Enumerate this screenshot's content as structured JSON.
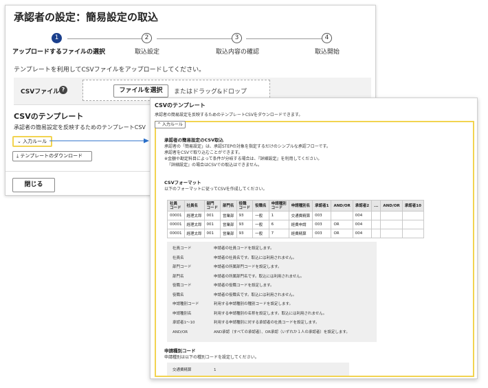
{
  "back_window": {
    "title": "承認者の設定：簡易設定の取込",
    "steps": [
      {
        "number": "1",
        "label": "アップロードするファイルの選択"
      },
      {
        "number": "2",
        "label": "取込設定"
      },
      {
        "number": "3",
        "label": "取込内容の確認"
      },
      {
        "number": "4",
        "label": "取込開始"
      }
    ],
    "description": "テンプレートを利用してCSVファイルをアップロードしてください。",
    "csv_file_label": "CSVファイル",
    "help_icon": "?",
    "select_file_button": "ファイルを選択",
    "drop_text": "またはドラッグ&ドロップ",
    "template_section_title": "CSVのテンプレート",
    "template_section_desc": "承認者の簡易設定を反映するためのテンプレートCSV",
    "input_rule_button": "⌄ 入力ルール",
    "download_button": "⤓ テンプレートのダウンロード",
    "close_button": "閉じる"
  },
  "front_window": {
    "title": "CSVのテンプレート",
    "description": "承認者の簡易設定を反映するためのテンプレートCSVをダウンロードできます。",
    "input_rule_button": "^ 入力ルール",
    "import_heading": "承認者の簡易設定のCSV取込",
    "import_lines": [
      "承認者の「簡易設定」は、承認STEPの対象を指定するだけのシンプルな承認フローです。",
      "承認者をCSVで取り込むことができます。",
      "※金額や勘定科目によって条件が分岐する場合は、『詳細設定』を利用してください。",
      "『詳細設定』の場合はCSVでの取込はできません。"
    ],
    "format_heading": "CSVフォーマット",
    "format_desc": "以下のフォーマットに従ってCSVを作成してください。",
    "table_headers": [
      "社員\nコード",
      "社員名",
      "部門\nコード",
      "部門名",
      "役職\nコード",
      "役職名",
      "申請種別\nコード",
      "申請種別名",
      "承認者1",
      "AND/OR",
      "承認者2",
      "...",
      "AND/OR",
      "承認者10"
    ],
    "table_rows": [
      [
        "00001",
        "経理太郎",
        "001",
        "営業部",
        "93",
        "一般",
        "1",
        "交通費精算",
        "003",
        "",
        "004",
        "",
        "",
        ""
      ],
      [
        "00001",
        "経理太郎",
        "001",
        "営業部",
        "93",
        "一般",
        "6",
        "経費申請",
        "003",
        "OR",
        "004",
        "",
        "",
        ""
      ],
      [
        "00001",
        "経理太郎",
        "001",
        "営業部",
        "93",
        "一般",
        "7",
        "経費精算",
        "003",
        "OR",
        "004",
        "",
        "",
        ""
      ]
    ],
    "definitions": [
      {
        "name": "社員コード",
        "desc": "申請者の社員コードを設定します。"
      },
      {
        "name": "社員名",
        "desc": "申請者の社員名です。取込には利用されません。"
      },
      {
        "name": "部門コード",
        "desc": "申請者の所属部門コードを設定します。"
      },
      {
        "name": "部門名",
        "desc": "申請者の所属部門名です。取込には利用されません。"
      },
      {
        "name": "役職コード",
        "desc": "申請者の役職コードを設定します。"
      },
      {
        "name": "役職名",
        "desc": "申請者の役職名です。取込には利用されません。"
      },
      {
        "name": "申請種別コード",
        "desc": "利用する申請種別の種別コードを設定します。"
      },
      {
        "name": "申請種別名",
        "desc": "利用する申請種別の名称を設定します。取込には利用されません。"
      },
      {
        "name": "承認者1〜10",
        "desc": "利用する申請種別に対する承認者の社員コードを設定します。"
      },
      {
        "name": "AND/OR",
        "desc": "AND承認（すべての承認者）、OR承認（いずれか１人の承認者）を設定します。"
      }
    ],
    "category_heading": "申請種別コード",
    "category_desc": "申請種別は以下の種別コードを設定してください。",
    "category_rows": [
      {
        "name": "交通費精算",
        "code": "1"
      }
    ]
  },
  "colors": {
    "accent_blue": "#1a3f8c",
    "highlight_yellow": "#f2d34f",
    "connector_blue": "#2a6fc9"
  }
}
